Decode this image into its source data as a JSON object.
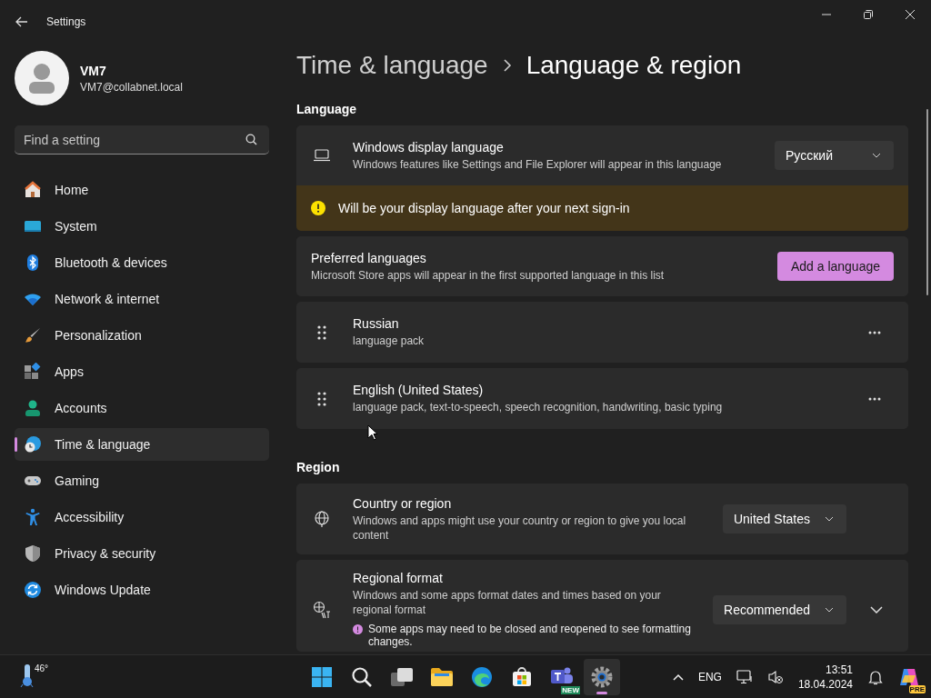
{
  "window": {
    "title": "Settings"
  },
  "account": {
    "name": "VM7",
    "email": "VM7@collabnet.local"
  },
  "search": {
    "placeholder": "Find a setting"
  },
  "nav": [
    {
      "kind": "home",
      "label": "Home",
      "selected": false
    },
    {
      "kind": "system",
      "label": "System",
      "selected": false
    },
    {
      "kind": "bluetooth",
      "label": "Bluetooth & devices",
      "selected": false
    },
    {
      "kind": "network",
      "label": "Network & internet",
      "selected": false
    },
    {
      "kind": "personalization",
      "label": "Personalization",
      "selected": false
    },
    {
      "kind": "apps",
      "label": "Apps",
      "selected": false
    },
    {
      "kind": "accounts",
      "label": "Accounts",
      "selected": false
    },
    {
      "kind": "time",
      "label": "Time & language",
      "selected": true
    },
    {
      "kind": "gaming",
      "label": "Gaming",
      "selected": false
    },
    {
      "kind": "accessibility",
      "label": "Accessibility",
      "selected": false
    },
    {
      "kind": "privacy",
      "label": "Privacy & security",
      "selected": false
    },
    {
      "kind": "update",
      "label": "Windows Update",
      "selected": false
    }
  ],
  "breadcrumb": [
    "Time & language",
    "Language & region"
  ],
  "language": {
    "heading": "Language",
    "display": {
      "title": "Windows display language",
      "description": "Windows features like Settings and File Explorer will appear in this language",
      "value": "Русский",
      "notice": "Will be your display language after your next sign-in"
    },
    "preferred": {
      "title": "Preferred languages",
      "description": "Microsoft Store apps will appear in the first supported language in this list",
      "button": "Add a language"
    },
    "languages": [
      {
        "name": "Russian",
        "features": "language pack"
      },
      {
        "name": "English (United States)",
        "features": "language pack, text-to-speech, speech recognition, handwriting, basic typing"
      }
    ]
  },
  "region": {
    "heading": "Region",
    "country": {
      "title": "Country or region",
      "description": "Windows and apps might use your country or region to give you local content",
      "value": "United States"
    },
    "format": {
      "title": "Regional format",
      "description": "Windows and some apps format dates and times based on your regional format",
      "value": "Recommended",
      "note": "Some apps may need to be closed and reopened to see formatting changes.",
      "expanded": false
    }
  },
  "taskbar": {
    "weather": "46°",
    "apps": [
      {
        "kind": "start",
        "selected": false
      },
      {
        "kind": "search",
        "selected": false
      },
      {
        "kind": "taskview",
        "selected": false
      },
      {
        "kind": "explorer",
        "selected": false
      },
      {
        "kind": "edge",
        "selected": false
      },
      {
        "kind": "store",
        "selected": false
      },
      {
        "kind": "teams",
        "selected": false,
        "badge": "NEW"
      },
      {
        "kind": "settings",
        "selected": true
      }
    ],
    "language": "ENG",
    "time": "13:51",
    "date": "18.04.2024",
    "copilot_badge": "PRE"
  }
}
